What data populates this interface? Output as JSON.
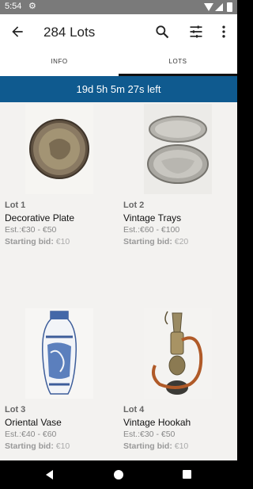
{
  "status": {
    "time": "5:54"
  },
  "header": {
    "title": "284 Lots"
  },
  "tabs": [
    {
      "label": "INFO"
    },
    {
      "label": "LOTS"
    }
  ],
  "timer": {
    "text": "19d 5h 5m 27s left"
  },
  "lots": [
    {
      "number": "Lot 1",
      "name": "Decorative Plate",
      "estimate": "Est.:€30 - €50",
      "starting_label": "Starting bid:",
      "starting_value": "€10"
    },
    {
      "number": "Lot 2",
      "name": "Vintage Trays",
      "estimate": "Est.:€60 - €100",
      "starting_label": "Starting bid:",
      "starting_value": "€20"
    },
    {
      "number": "Lot 3",
      "name": "Oriental Vase",
      "estimate": "Est.:€40 - €60",
      "starting_label": "Starting bid:",
      "starting_value": "€10"
    },
    {
      "number": "Lot 4",
      "name": "Vintage Hookah",
      "estimate": "Est.:€30 - €50",
      "starting_label": "Starting bid:",
      "starting_value": "€10"
    }
  ],
  "icons": {
    "back": "arrow-left-icon",
    "search": "search-icon",
    "filter": "tune-icon",
    "more": "more-vert-icon",
    "settings": "gear-icon"
  },
  "colors": {
    "banner": "#0f5a8f",
    "statusbar": "#7a7a7a",
    "background": "#f3f2f0"
  }
}
